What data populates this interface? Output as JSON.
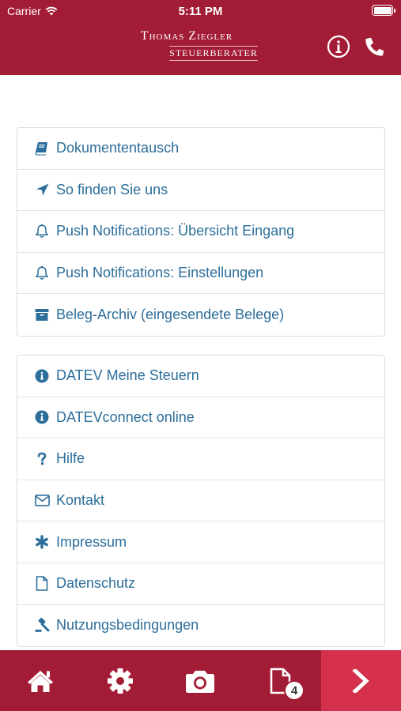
{
  "status": {
    "carrier": "Carrier",
    "time": "5:11 PM"
  },
  "header": {
    "logo_name": "Thomas Ziegler",
    "logo_sub": "STEUERBERATER"
  },
  "menu_group_1": [
    {
      "label": "Dokumententausch",
      "icon": "book-icon"
    },
    {
      "label": "So finden Sie uns",
      "icon": "location-arrow-icon"
    },
    {
      "label": "Push Notifications: Übersicht Eingang",
      "icon": "bell-icon"
    },
    {
      "label": "Push Notifications: Einstellungen",
      "icon": "bell-icon"
    },
    {
      "label": "Beleg-Archiv (eingesendete Belege)",
      "icon": "archive-icon"
    }
  ],
  "menu_group_2": [
    {
      "label": "DATEV Meine Steuern",
      "icon": "info-circle-icon"
    },
    {
      "label": "DATEVconnect online",
      "icon": "info-circle-icon"
    },
    {
      "label": "Hilfe",
      "icon": "question-icon"
    },
    {
      "label": "Kontakt",
      "icon": "envelope-icon"
    },
    {
      "label": "Impressum",
      "icon": "asterisk-icon"
    },
    {
      "label": "Datenschutz",
      "icon": "file-icon"
    },
    {
      "label": "Nutzungsbedingungen",
      "icon": "gavel-icon"
    }
  ],
  "tabbar": {
    "documents_badge": "4"
  },
  "colors": {
    "brand": "#a31c35",
    "accent": "#d4304b",
    "link": "#2c6e9b"
  }
}
